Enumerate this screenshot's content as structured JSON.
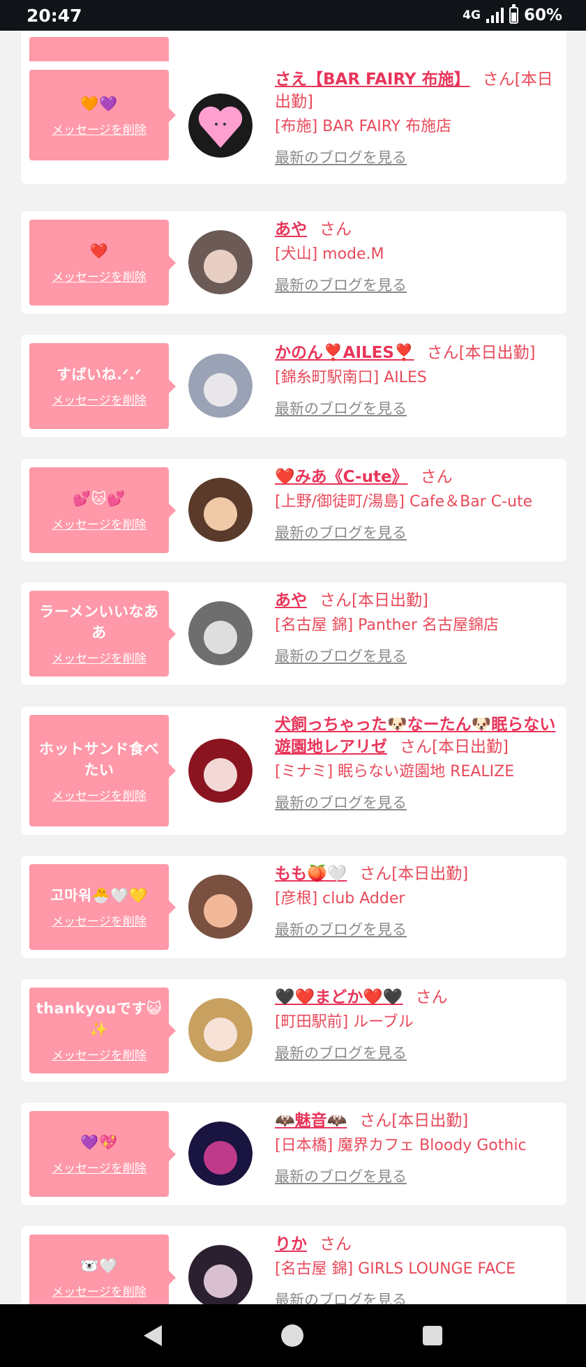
{
  "status": {
    "time": "20:47",
    "network": "4G",
    "battery": "60%"
  },
  "delete_label": "メッセージを削除",
  "blog_label": "最新のブログを見る",
  "cards": [
    {
      "message": "🧡💜",
      "name": "さえ【BAR FAIRY 布施】",
      "suffix": "さん[本日出勤]",
      "shop": "[布施] BAR FAIRY 布施店",
      "avatar_colors": [
        "#1a1a1a",
        "#ff9fd0"
      ]
    },
    {
      "message": "❤️",
      "name": "あや",
      "suffix": "さん",
      "shop": "[犬山] mode.M",
      "avatar_colors": [
        "#6b5a55",
        "#e8cfc4"
      ]
    },
    {
      "message": "すばいね.ᐟ.ᐟ",
      "name": "かのん❣️AILES❣️",
      "suffix": "さん[本日出勤]",
      "shop": "[錦糸町駅南口] AILES",
      "avatar_colors": [
        "#9aa3b5",
        "#e9e6ea"
      ]
    },
    {
      "message": "💕🐱💕",
      "name": "❤️みあ《C-ute》",
      "suffix": "さん",
      "shop": "[上野/御徒町/湯島] Cafe＆Bar C-ute",
      "avatar_colors": [
        "#5a3a2a",
        "#f0c9a8"
      ]
    },
    {
      "message": "ラーメンいいなああ",
      "name": "あや",
      "suffix": "さん[本日出勤]",
      "shop": "[名古屋 錦] Panther 名古屋錦店",
      "avatar_colors": [
        "#6e6e6e",
        "#dedede"
      ]
    },
    {
      "message": "ホットサンド食べたい",
      "name": "犬飼っちゃった🐶なーたん🐶眠らない遊園地レアリゼ",
      "suffix": "さん[本日出勤]",
      "shop": "[ミナミ] 眠らない遊園地 REALIZE",
      "avatar_colors": [
        "#8a1420",
        "#f3d9d6"
      ]
    },
    {
      "message": "고마워🐣🤍💛",
      "name": "もも🍑🤍",
      "suffix": "さん[本日出勤]",
      "shop": "[彦根] club Adder",
      "avatar_colors": [
        "#7a5040",
        "#f2b89a"
      ]
    },
    {
      "message": "thankyouです😺✨",
      "name": "🖤❤️まどか❤️🖤",
      "suffix": "さん",
      "shop": "[町田駅前] ルーブル",
      "avatar_colors": [
        "#c8a060",
        "#f7e2d8"
      ]
    },
    {
      "message": "💜💖",
      "name": "🦇魅音🦇",
      "suffix": "さん[本日出勤]",
      "shop": "[日本橋] 魔界カフェ Bloody Gothic",
      "avatar_colors": [
        "#1a1440",
        "#c03a8a"
      ]
    },
    {
      "message": "🐻‍❄️🤍",
      "name": "りか",
      "suffix": "さん",
      "shop": "[名古屋 錦] GIRLS LOUNGE FACE",
      "avatar_colors": [
        "#2a2030",
        "#d8c0d0"
      ]
    }
  ]
}
